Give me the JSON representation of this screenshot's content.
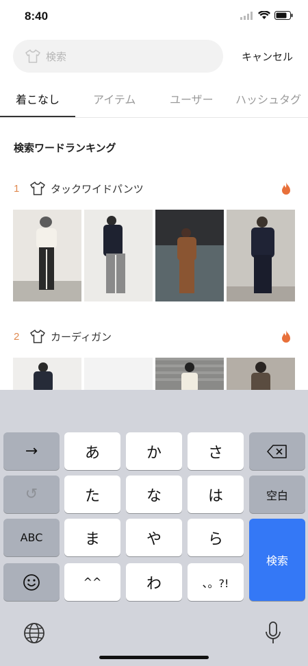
{
  "status": {
    "time": "8:40"
  },
  "search": {
    "placeholder": "検索",
    "cancel_label": "キャンセル"
  },
  "tabs": [
    {
      "label": "着こなし",
      "active": true
    },
    {
      "label": "アイテム",
      "active": false
    },
    {
      "label": "ユーザー",
      "active": false
    },
    {
      "label": "ハッシュタグ",
      "active": false
    }
  ],
  "ranking": {
    "title": "検索ワードランキング",
    "items": [
      {
        "rank": "1",
        "label": "タックワイドパンツ",
        "icon": "tshirt-icon",
        "badge_icon": "fire-icon"
      },
      {
        "rank": "2",
        "label": "カーディガン",
        "icon": "tshirt-icon",
        "badge_icon": "fire-icon"
      }
    ]
  },
  "keyboard": {
    "row1": [
      "→",
      "あ",
      "か",
      "さ",
      "⌫"
    ],
    "row2": [
      "↺",
      "た",
      "な",
      "は",
      "空白"
    ],
    "row3": [
      "ABC",
      "ま",
      "や",
      "ら"
    ],
    "row4": [
      "☺",
      "^^",
      "わ",
      "、。?!"
    ],
    "search_key": "検索"
  },
  "colors": {
    "accent": "#e08a50",
    "fire": "#e8703a",
    "keyboard_search": "#3478f6"
  }
}
